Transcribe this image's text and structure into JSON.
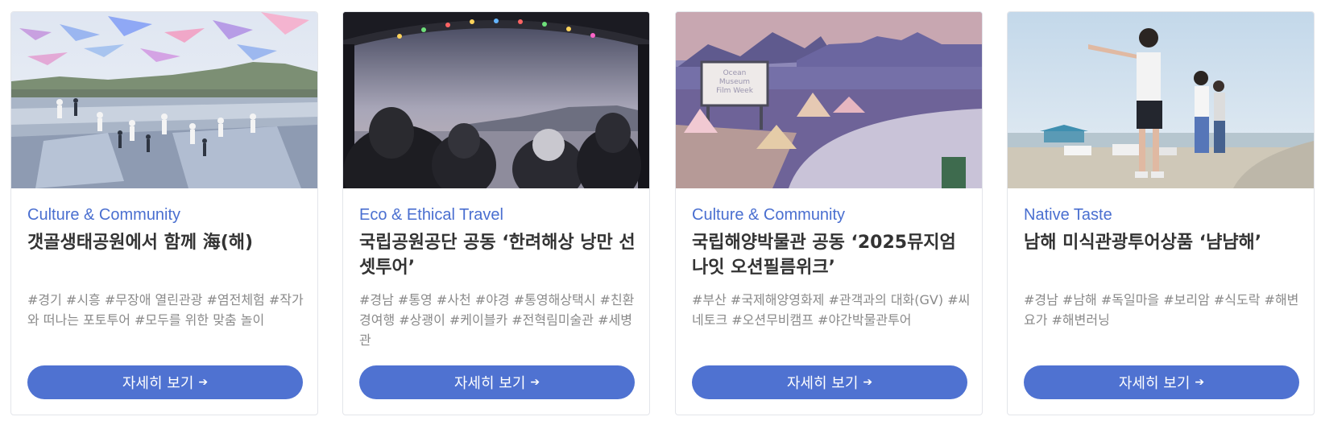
{
  "cards": [
    {
      "category": "Culture & Community",
      "title": "갯골생태공원에서 함께 海(해)",
      "tags": "#경기 #시흥 #무장애 열린관광 #염전체험 #작가와 떠나는 포토투어 #모두를 위한 맞춤 놀이",
      "button_label": "자세히 보기",
      "button_icon": "arrow-right-icon",
      "image_icon": "salt-field-photo"
    },
    {
      "category": "Eco & Ethical Travel",
      "title": "국립공원공단 공동 ‘한려해상 낭만 선셋투어’",
      "tags": "#경남 #통영 #사천 #야경 #통영해상택시 #친환경여행 #상괭이 #케이블카 #전혁림미술관 #세병관",
      "button_label": "자세히 보기",
      "button_icon": "arrow-right-icon",
      "image_icon": "sunset-boat-photo"
    },
    {
      "category": "Culture & Community",
      "title": "국립해양박물관 공동 ‘2025뮤지엄나잇 오션필름위크’",
      "tags": "#부산 #국제해양영화제 #관객과의 대화(GV) #씨네토크 #오션무비캠프 #야간박물관투어",
      "button_label": "자세히 보기",
      "button_icon": "arrow-right-icon",
      "image_icon": "film-week-illustration",
      "image_text": "Ocean Museum Film Week"
    },
    {
      "category": "Native Taste",
      "title": "남해 미식관광투어상품 ‘냠냠해’",
      "tags": "#경남 #남해 #독일마을 #보리암 #식도락 #해변요가 #해변러닝",
      "button_label": "자세히 보기",
      "button_icon": "arrow-right-icon",
      "image_icon": "beach-hikers-photo"
    }
  ],
  "colors": {
    "accent": "#4f72d1",
    "category_text": "#4a6fd0",
    "title_text": "#333333",
    "tag_text": "#8a8a8a"
  }
}
